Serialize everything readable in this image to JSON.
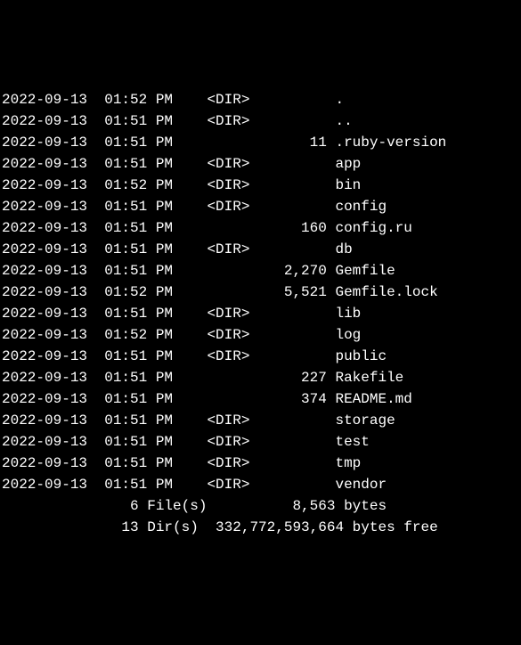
{
  "entries": [
    {
      "date": "2022-09-13",
      "time": "01:52 PM",
      "type": "<DIR>",
      "size": "",
      "name": "."
    },
    {
      "date": "2022-09-13",
      "time": "01:51 PM",
      "type": "<DIR>",
      "size": "",
      "name": ".."
    },
    {
      "date": "2022-09-13",
      "time": "01:51 PM",
      "type": "",
      "size": "11",
      "name": ".ruby-version"
    },
    {
      "date": "2022-09-13",
      "time": "01:51 PM",
      "type": "<DIR>",
      "size": "",
      "name": "app"
    },
    {
      "date": "2022-09-13",
      "time": "01:52 PM",
      "type": "<DIR>",
      "size": "",
      "name": "bin"
    },
    {
      "date": "2022-09-13",
      "time": "01:51 PM",
      "type": "<DIR>",
      "size": "",
      "name": "config"
    },
    {
      "date": "2022-09-13",
      "time": "01:51 PM",
      "type": "",
      "size": "160",
      "name": "config.ru"
    },
    {
      "date": "2022-09-13",
      "time": "01:51 PM",
      "type": "<DIR>",
      "size": "",
      "name": "db"
    },
    {
      "date": "2022-09-13",
      "time": "01:51 PM",
      "type": "",
      "size": "2,270",
      "name": "Gemfile"
    },
    {
      "date": "2022-09-13",
      "time": "01:52 PM",
      "type": "",
      "size": "5,521",
      "name": "Gemfile.lock"
    },
    {
      "date": "2022-09-13",
      "time": "01:51 PM",
      "type": "<DIR>",
      "size": "",
      "name": "lib"
    },
    {
      "date": "2022-09-13",
      "time": "01:52 PM",
      "type": "<DIR>",
      "size": "",
      "name": "log"
    },
    {
      "date": "2022-09-13",
      "time": "01:51 PM",
      "type": "<DIR>",
      "size": "",
      "name": "public"
    },
    {
      "date": "2022-09-13",
      "time": "01:51 PM",
      "type": "",
      "size": "227",
      "name": "Rakefile"
    },
    {
      "date": "2022-09-13",
      "time": "01:51 PM",
      "type": "",
      "size": "374",
      "name": "README.md"
    },
    {
      "date": "2022-09-13",
      "time": "01:51 PM",
      "type": "<DIR>",
      "size": "",
      "name": "storage"
    },
    {
      "date": "2022-09-13",
      "time": "01:51 PM",
      "type": "<DIR>",
      "size": "",
      "name": "test"
    },
    {
      "date": "2022-09-13",
      "time": "01:51 PM",
      "type": "<DIR>",
      "size": "",
      "name": "tmp"
    },
    {
      "date": "2022-09-13",
      "time": "01:51 PM",
      "type": "<DIR>",
      "size": "",
      "name": "vendor"
    }
  ],
  "summary": {
    "files_line": "               6 File(s)          8,563 bytes",
    "dirs_line": "              13 Dir(s)  332,772,593,664 bytes free"
  }
}
